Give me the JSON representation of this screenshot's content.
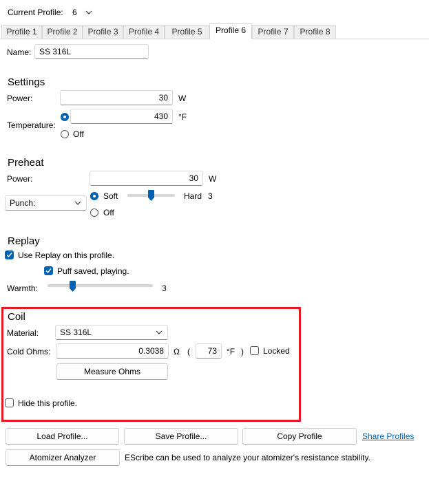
{
  "top": {
    "current_profile_label": "Current Profile:",
    "current_profile_value": "6"
  },
  "tabs": [
    {
      "label": "Profile 1"
    },
    {
      "label": "Profile 2"
    },
    {
      "label": "Profile 3"
    },
    {
      "label": "Profile 4"
    },
    {
      "label": "Profile 5"
    },
    {
      "label": "Profile 6"
    },
    {
      "label": "Profile 7"
    },
    {
      "label": "Profile 8"
    }
  ],
  "active_tab": "Profile 6",
  "name": {
    "label": "Name:",
    "value": "SS 316L"
  },
  "settings": {
    "heading": "Settings",
    "power_label": "Power:",
    "power_value": "30",
    "power_unit": "W",
    "temperature_label": "Temperature:",
    "temperature_value": "430",
    "temperature_unit": "°F",
    "off_label": "Off",
    "temperature_selected": true
  },
  "preheat": {
    "heading": "Preheat",
    "power_label": "Power:",
    "power_value": "30",
    "power_unit": "W",
    "punch_label": "Punch:",
    "soft_label": "Soft",
    "hard_label": "Hard",
    "slider_value": "3",
    "slider_max": 5,
    "off_label": "Off",
    "soft_selected": true
  },
  "replay": {
    "heading": "Replay",
    "use_replay_label": "Use Replay on this profile.",
    "use_replay_checked": true,
    "puff_saved_label": "Puff saved, playing.",
    "puff_saved_checked": true,
    "warmth_label": "Warmth:",
    "warmth_value": "3",
    "warmth_max": 10
  },
  "coil": {
    "heading": "Coil",
    "material_label": "Material:",
    "material_value": "SS 316L",
    "cold_ohms_label": "Cold Ohms:",
    "cold_ohms_value": "0.3038",
    "ohm_symbol": "Ω",
    "paren_open": "(",
    "temp_value": "73",
    "temp_unit": "°F",
    "paren_close": ")",
    "locked_label": "Locked",
    "locked_checked": false,
    "measure_button": "Measure Ohms",
    "hide_label": "Hide this profile.",
    "hide_checked": false
  },
  "bottom": {
    "load_button": "Load Profile...",
    "save_button": "Save Profile...",
    "copy_button": "Copy Profile",
    "share_link": "Share Profiles",
    "analyzer_button": "Atomizer Analyzer",
    "analyzer_text": "EScribe can be used to analyze your atomizer's resistance stability."
  },
  "colors": {
    "accent": "#0063b1",
    "highlight": "#e01b24"
  }
}
